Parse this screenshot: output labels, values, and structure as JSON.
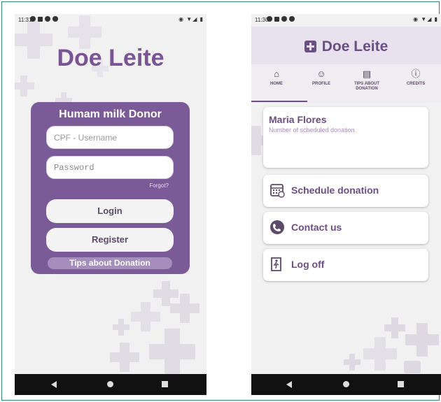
{
  "colors": {
    "brand_purple": "#7b5b97",
    "title_purple": "#7a5494",
    "accent_purple": "#6c4e86",
    "light_lilac": "#e8e1ee"
  },
  "left_screen": {
    "status_time": "11:31",
    "app_title": "Doe Leite",
    "card_title": "Humam milk Donor",
    "username_placeholder": "CPF - Username",
    "password_placeholder": "Password",
    "forgot_label": "Forgot?",
    "login_label": "Login",
    "register_label": "Register",
    "tips_label": "Tips about Donation"
  },
  "right_screen": {
    "status_time": "11:30",
    "app_title": "Doe Leite",
    "tabs": [
      {
        "label": "HOME",
        "icon": "home-icon"
      },
      {
        "label": "PROFILE",
        "icon": "account-icon"
      },
      {
        "label": "TIPS ABOUT DONATION",
        "icon": "clipboard-icon"
      },
      {
        "label": "CREDITS",
        "icon": "info-icon"
      }
    ],
    "active_tab": "HOME",
    "user": {
      "name": "Maria Flores",
      "subtitle": "Number of scheduled donation."
    },
    "menu": [
      {
        "label": "Schedule donation",
        "icon": "calendar-icon"
      },
      {
        "label": "Contact us",
        "icon": "phone-icon"
      },
      {
        "label": "Log off",
        "icon": "exit-door-icon"
      }
    ]
  }
}
